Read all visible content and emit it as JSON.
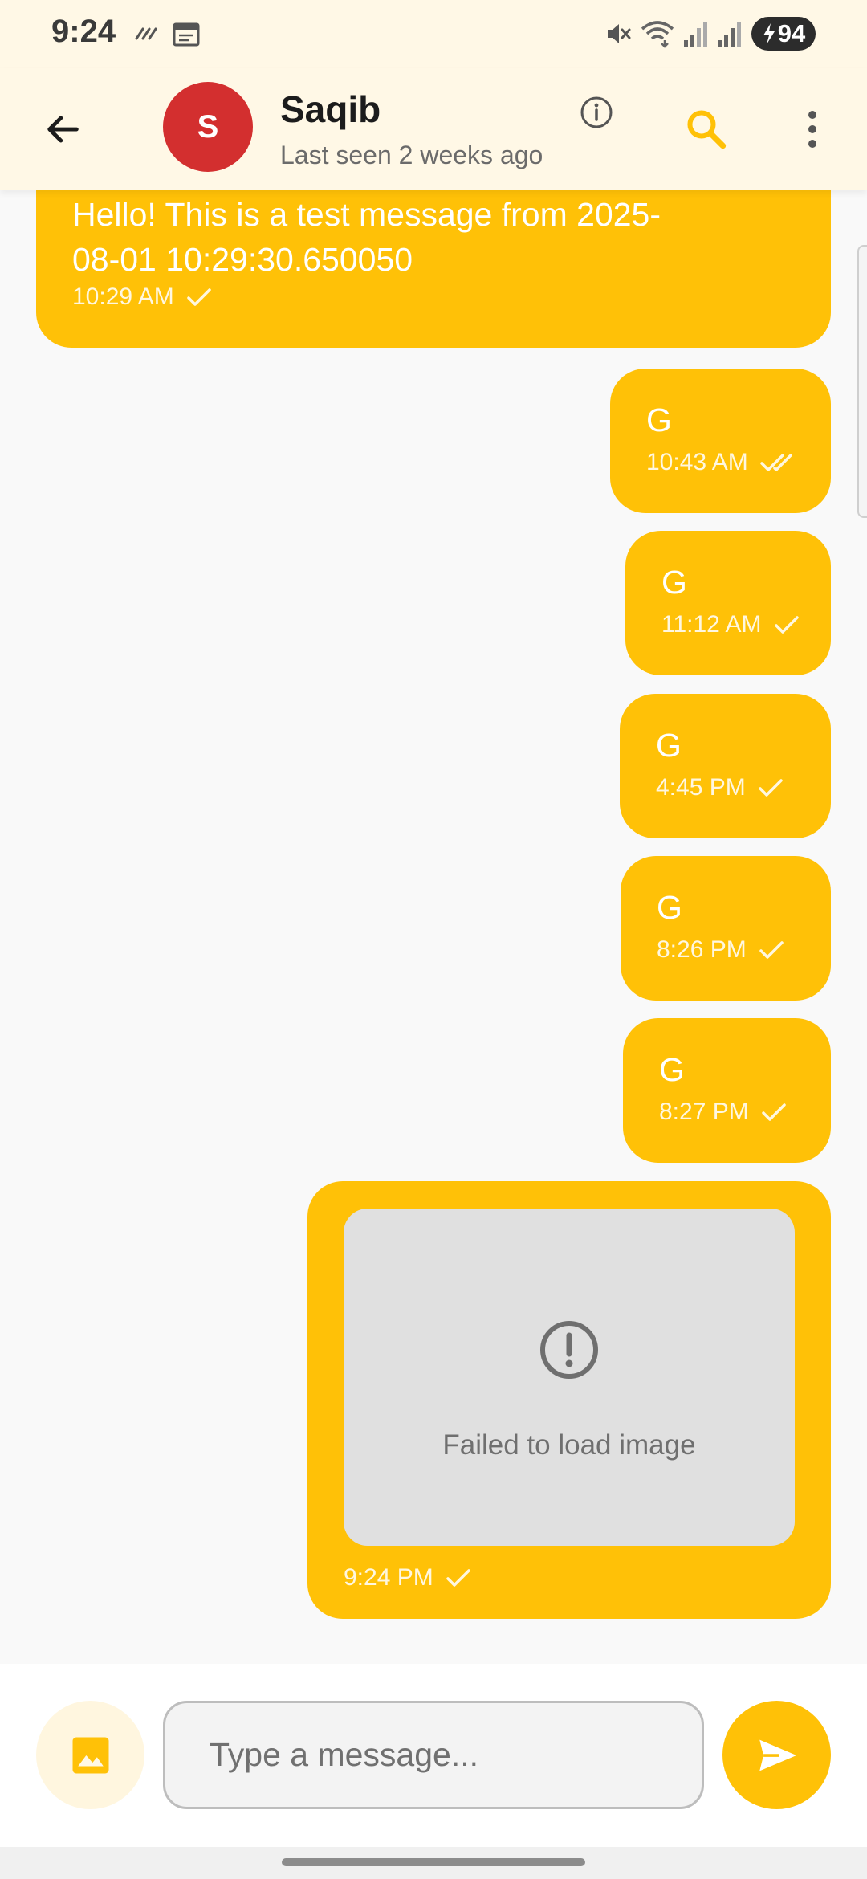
{
  "status_bar": {
    "time": "9:24",
    "battery": "94",
    "icons": [
      "data-saver-icon",
      "calendar-icon",
      "mute-icon",
      "wifi-icon",
      "signal-icon",
      "signal-icon",
      "battery-charging-icon"
    ]
  },
  "header": {
    "back_icon": "arrow-back-icon",
    "avatar_letter": "S",
    "avatar_color": "#d32f2f",
    "contact_name": "Saqib",
    "last_seen": "Last seen 2 weeks ago",
    "info_icon": "info-icon",
    "search_icon": "search-icon",
    "menu_icon": "more-vert-icon"
  },
  "messages": [
    {
      "text": "Hello! This is a test message from 2025-08-01 10:29:30.650050",
      "time": "10:29 AM",
      "status": "sent"
    },
    {
      "text": "G",
      "time": "10:43 AM",
      "status": "read"
    },
    {
      "text": "G",
      "time": "11:12 AM",
      "status": "sent"
    },
    {
      "text": "G",
      "time": "4:45 PM",
      "status": "sent"
    },
    {
      "text": "G",
      "time": "8:26 PM",
      "status": "sent"
    },
    {
      "text": "G",
      "time": "8:27 PM",
      "status": "sent"
    },
    {
      "image_error": "Failed to load image",
      "time": "9:24 PM",
      "status": "sent"
    }
  ],
  "composer": {
    "placeholder": "Type a message...",
    "gallery_icon": "image-icon",
    "send_icon": "send-icon"
  },
  "colors": {
    "accent": "#ffc107",
    "header_bg": "#fff8e6",
    "chat_bg": "#f9f9f9"
  }
}
